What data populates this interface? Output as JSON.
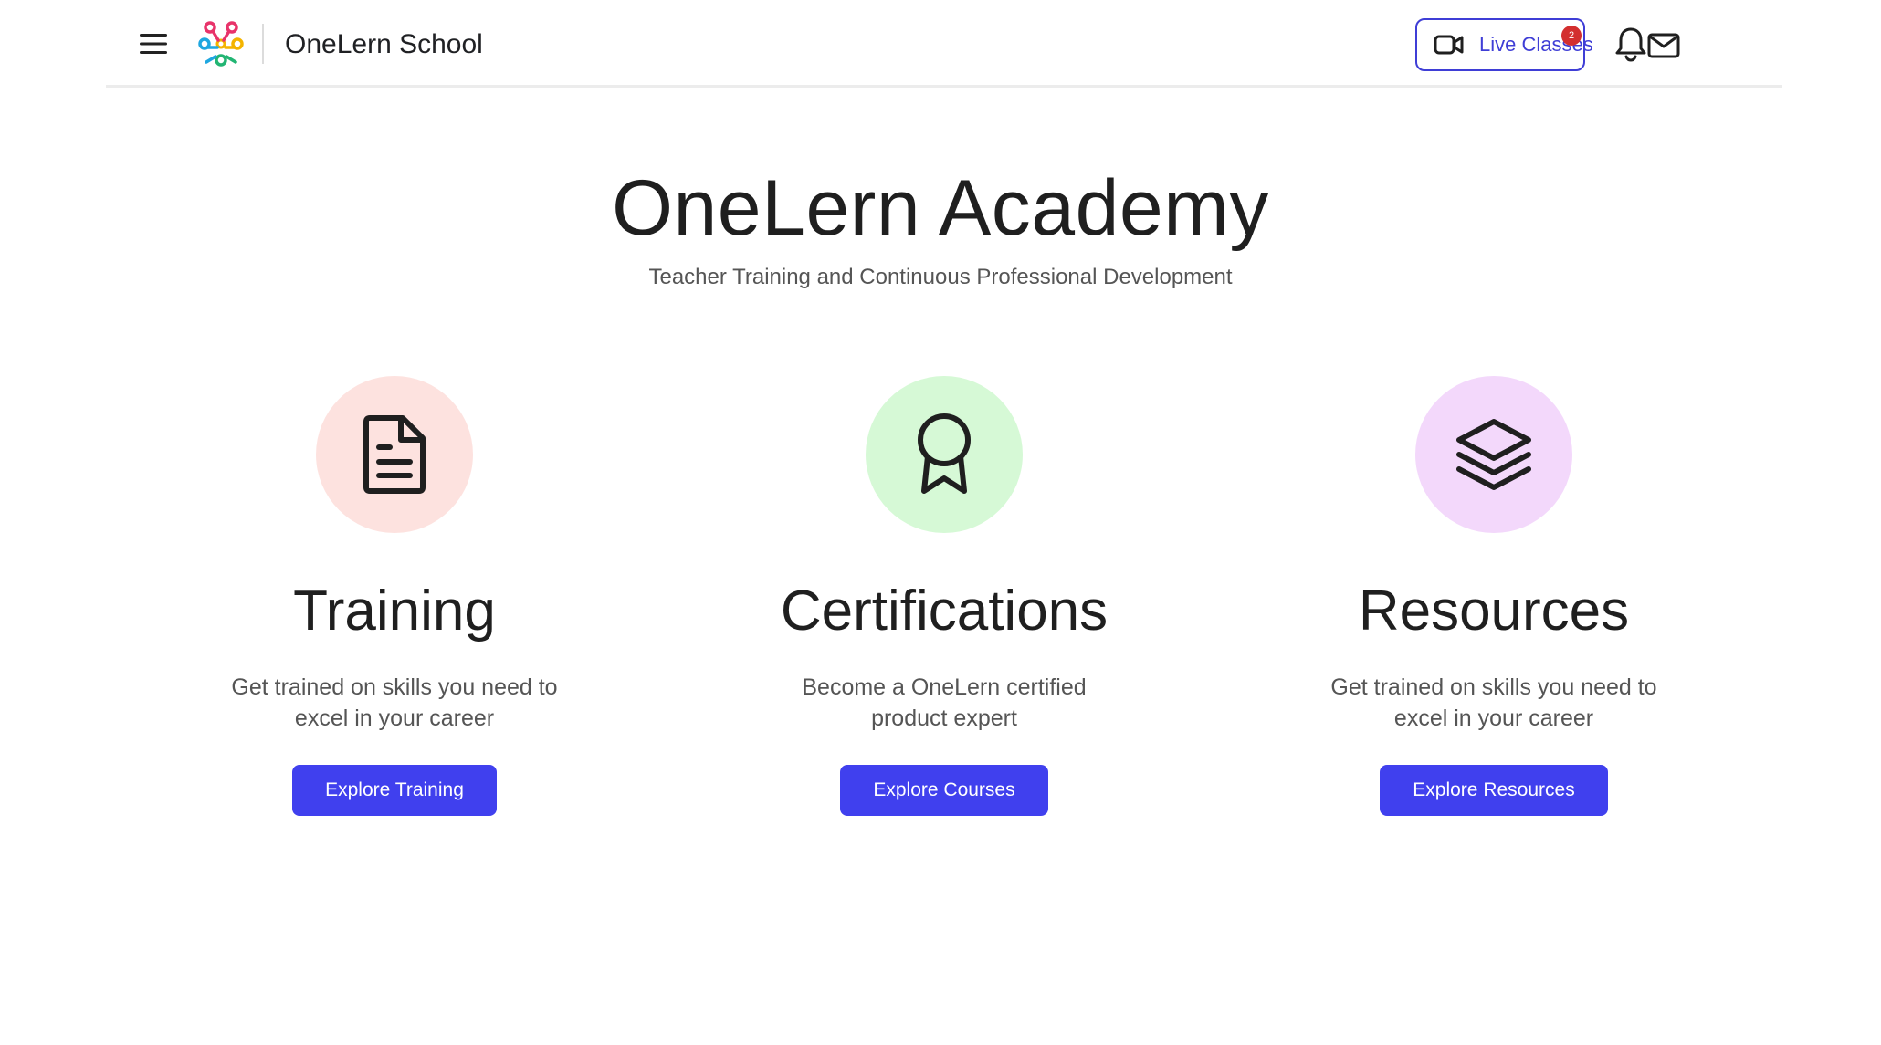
{
  "header": {
    "school_name": "OneLern School",
    "live_classes_label": "Live Classes",
    "mail_badge_count": "2"
  },
  "hero": {
    "title": "OneLern Academy",
    "subtitle": "Teacher Training and Continuous Professional Development"
  },
  "cards": [
    {
      "icon": "document-icon",
      "circle_color": "#fde2df",
      "title": "Training",
      "description": "Get trained on skills you need to excel in your career",
      "button_label": "Explore Training"
    },
    {
      "icon": "award-ribbon-icon",
      "circle_color": "#d6f9d6",
      "title": "Certifications",
      "description": "Become a OneLern certified product expert",
      "button_label": "Explore Courses"
    },
    {
      "icon": "layers-icon",
      "circle_color": "#f3d8fb",
      "title": "Resources",
      "description": "Get trained on skills you need to excel in your career",
      "button_label": "Explore Resources"
    }
  ],
  "colors": {
    "accent": "#4040ee",
    "outline_accent": "#3f3ed6",
    "badge": "#d32f2f"
  }
}
